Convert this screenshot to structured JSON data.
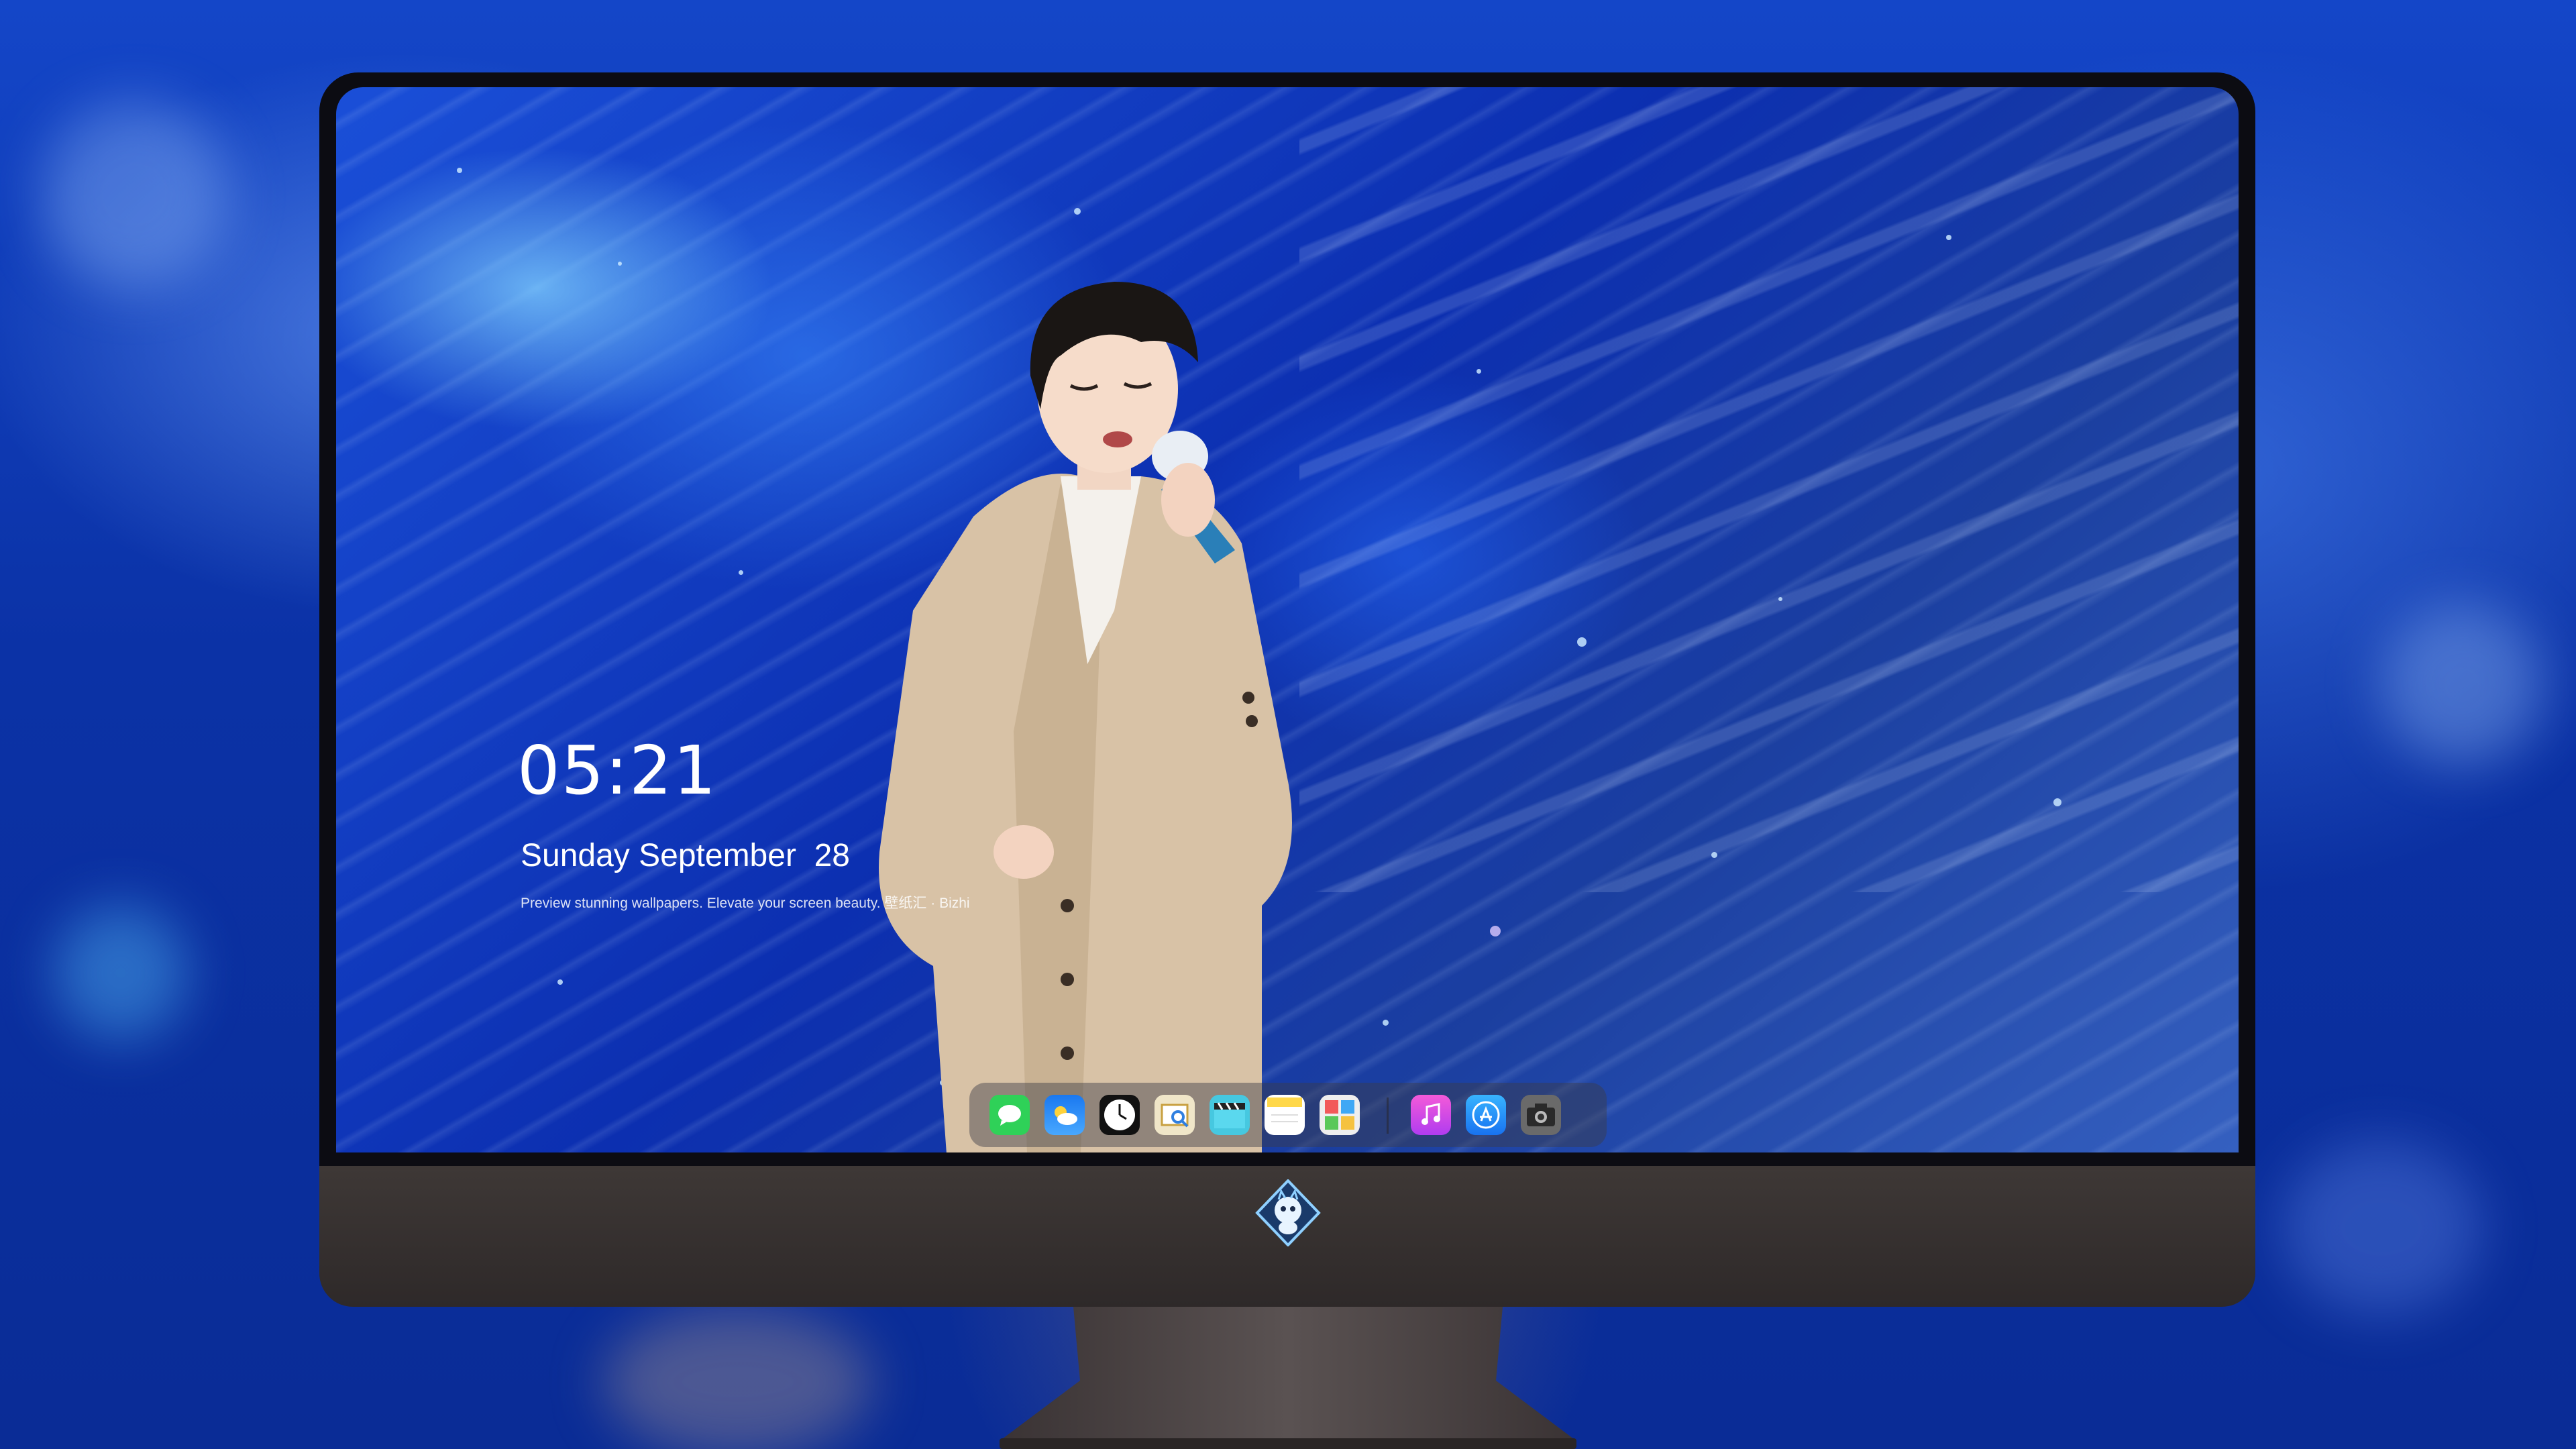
{
  "lockscreen": {
    "time": "05:21",
    "date": "Sunday September  28",
    "tagline": "Preview stunning wallpapers. Elevate your screen beauty. 壁纸汇 · Bizhi"
  },
  "dock": {
    "apps": [
      {
        "name": "messages-icon",
        "color": "#2fd158"
      },
      {
        "name": "weather-icon",
        "color": "#2c8bff"
      },
      {
        "name": "clock-icon",
        "color": "#111111"
      },
      {
        "name": "preview-icon",
        "color": "#f0c040"
      },
      {
        "name": "clips-icon",
        "color": "#46c8e0"
      },
      {
        "name": "notes-icon",
        "color": "#ffd84a"
      },
      {
        "name": "photos-grid-icon",
        "color": "#e8e8e8"
      },
      {
        "name": "music-icon",
        "color": "#e042c8"
      },
      {
        "name": "app-store-icon",
        "color": "#1e8cff"
      },
      {
        "name": "camera-icon",
        "color": "#6a6a6a"
      }
    ]
  },
  "colors": {
    "screen_blue": "#1a4fd8",
    "bezel": "#0c0c12",
    "chin": "#3e3836"
  }
}
